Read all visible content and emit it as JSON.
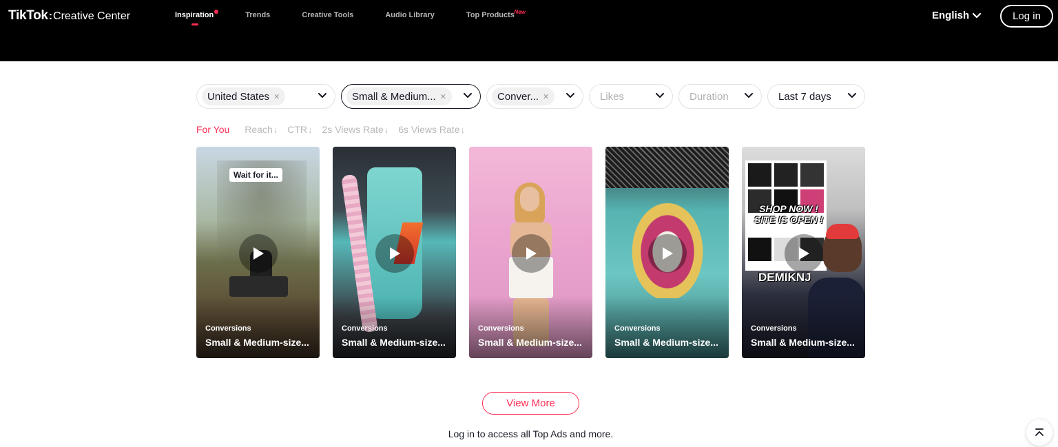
{
  "header": {
    "logo_main": "TikTok",
    "logo_colon": ":",
    "logo_sub": "Creative Center",
    "nav": [
      {
        "label": "Inspiration"
      },
      {
        "label": "Trends"
      },
      {
        "label": "Creative Tools"
      },
      {
        "label": "Audio Library"
      },
      {
        "label": "Top Products",
        "badge": "New"
      }
    ],
    "language": "English",
    "login": "Log in"
  },
  "filters": {
    "region": {
      "value": "United States"
    },
    "industry": {
      "value": "Small & Medium..."
    },
    "objective": {
      "value": "Conver..."
    },
    "likes": {
      "placeholder": "Likes"
    },
    "duration": {
      "placeholder": "Duration"
    },
    "period": {
      "value": "Last 7 days"
    }
  },
  "sort": [
    {
      "label": "For You"
    },
    {
      "label": "Reach"
    },
    {
      "label": "CTR"
    },
    {
      "label": "2s Views Rate"
    },
    {
      "label": "6s Views Rate"
    }
  ],
  "cards": [
    {
      "objective": "Conversions",
      "industry": "Small & Medium-size...",
      "caption": "Wait for it..."
    },
    {
      "objective": "Conversions",
      "industry": "Small & Medium-size..."
    },
    {
      "objective": "Conversions",
      "industry": "Small & Medium-size..."
    },
    {
      "objective": "Conversions",
      "industry": "Small & Medium-size..."
    },
    {
      "objective": "Conversions",
      "industry": "Small & Medium-size...",
      "overlay_line1": "SHOP NOW !",
      "overlay_line2": "SITE IS OPEN !",
      "overlay_name": "DEMIKNJ"
    }
  ],
  "footer": {
    "view_more": "View More",
    "login_note": "Log in to access all Top Ads and more."
  },
  "colors": {
    "accent": "#fe2c55",
    "header_bg": "#000000",
    "text": "#161823"
  }
}
